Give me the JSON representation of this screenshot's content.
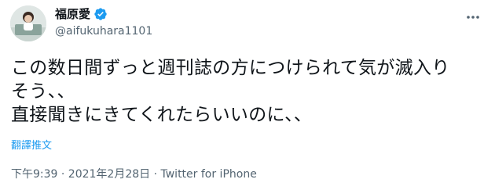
{
  "header": {
    "display_name": "福原愛",
    "handle": "@aifukuhara1101"
  },
  "tweet": {
    "text": "この数日間ずっと週刊誌の方につけられて気が滅入り\nそう、、\n直接聞きにきてくれたらいいのに、、"
  },
  "translate_label": "翻譯推文",
  "meta": {
    "timestamp": "下午9:39 · 2021年2月28日 · Twitter for iPhone"
  },
  "colors": {
    "accent": "#1d9bf0",
    "secondary_text": "#536471"
  },
  "icons": [
    "verified-badge-icon",
    "more-options-icon"
  ]
}
